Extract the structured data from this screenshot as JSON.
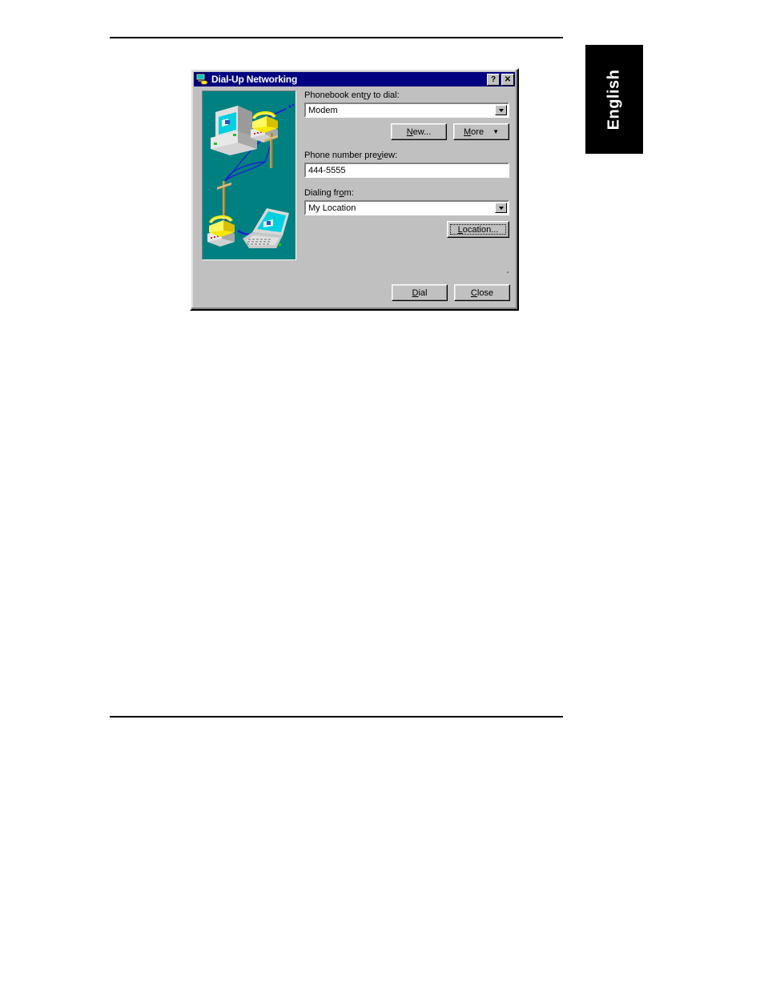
{
  "page": {
    "language_tab": "English",
    "rules": [
      "top-rule",
      "bottom-rule"
    ]
  },
  "dialog": {
    "title": "Dial-Up Networking",
    "titlebar_icon": "dial-up-networking-icon",
    "titlebar_buttons": [
      {
        "name": "help-button",
        "label": "?"
      },
      {
        "name": "close-button",
        "label": "✕"
      }
    ],
    "illustration": {
      "name": "dial-up-illustration",
      "background": "#008080",
      "elements": [
        "desktop-computer",
        "telephone-top",
        "telephone-pole-right",
        "telephone-pole-left",
        "telephone-bottom",
        "laptop-computer",
        "phone-lines"
      ]
    },
    "fields": {
      "phonebook": {
        "label_pre": "Phonebook ent",
        "label_accel": "r",
        "label_post": "y to dial:",
        "label_full": "Phonebook entry to dial:",
        "value": "Modem"
      },
      "preview": {
        "label_pre": "Phone number pre",
        "label_accel": "v",
        "label_post": "iew:",
        "label_full": "Phone number preview:",
        "value": "444-5555"
      },
      "dialing_from": {
        "label_pre": "Dialing fr",
        "label_accel": "o",
        "label_post": "m:",
        "label_full": "Dialing from:",
        "value": "My Location"
      }
    },
    "buttons": {
      "new": {
        "pre": "",
        "accel": "N",
        "post": "ew...",
        "full": "New..."
      },
      "more": {
        "pre": "",
        "accel": "M",
        "post": "ore",
        "full": "More",
        "arrow": "▼"
      },
      "location": {
        "pre": "",
        "accel": "L",
        "post": "ocation...",
        "full": "Location..."
      },
      "dial": {
        "pre": "",
        "accel": "D",
        "post": "ial",
        "full": "Dial"
      },
      "close": {
        "pre": "",
        "accel": "C",
        "post": "lose",
        "full": "Close"
      }
    }
  }
}
